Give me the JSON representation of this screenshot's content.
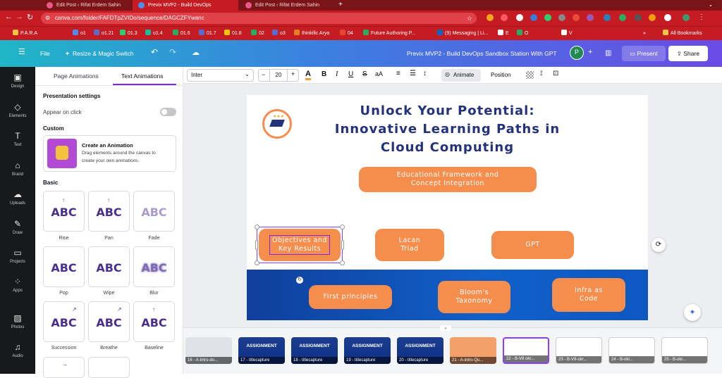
{
  "browser": {
    "tabs": [
      {
        "label": "Edit Post ‹ Rifat Erdem Sahin"
      },
      {
        "label": "Previx MVP2 - Build DevOps"
      },
      {
        "label": "Edit Post ‹ Rifat Erdem Sahin"
      }
    ],
    "url": "canva.com/folder/FAFDTpZVIDo/sequence/DAGCZFYwanc",
    "bookmarks": [
      "P.A.R.A",
      "o1",
      "o1.21",
      "01.3",
      "o1.4",
      "01.6",
      "01.7",
      "01.8",
      "02",
      "o3",
      "thinkific Arya",
      "04",
      "Future Authoring P...",
      "(9) Messaging | Li...",
      "E",
      "O",
      "V",
      "All Bookmarks"
    ],
    "colors": {
      "frame": "#c51c24"
    }
  },
  "header": {
    "menu_icon": "hamburger-icon",
    "file_label": "File",
    "resize_label": "Resize & Magic Switch",
    "doc_title": "Previx MVP2 - Build DevOps Sandbox Station  With GPT",
    "avatar_initial": "P",
    "present_label": "Present",
    "share_label": "Share"
  },
  "rail": {
    "items": [
      {
        "label": "Design",
        "icon": "design-icon"
      },
      {
        "label": "Elements",
        "icon": "elements-icon"
      },
      {
        "label": "Text",
        "icon": "text-icon"
      },
      {
        "label": "Brand",
        "icon": "brand-icon"
      },
      {
        "label": "Uploads",
        "icon": "uploads-icon"
      },
      {
        "label": "Draw",
        "icon": "draw-icon"
      },
      {
        "label": "Projects",
        "icon": "projects-icon"
      },
      {
        "label": "Apps",
        "icon": "apps-icon"
      },
      {
        "label": "Photos",
        "icon": "photos-icon"
      },
      {
        "label": "Audio",
        "icon": "audio-icon"
      }
    ]
  },
  "panel": {
    "tab_page": "Page Animations",
    "tab_text": "Text Animations",
    "presentation_settings": "Presentation settings",
    "appear_on_click": "Appear on click",
    "custom": "Custom",
    "create_title": "Create an Animation",
    "create_desc_1": "Drag elements around the canvas to",
    "create_desc_2": "create your own animations.",
    "basic": "Basic",
    "abc": "ABC",
    "animations": [
      "Rise",
      "Pan",
      "Fade",
      "Pop",
      "Wipe",
      "Blur",
      "Succession",
      "Breathe",
      "Baseline"
    ]
  },
  "toolbar": {
    "font": "Inter",
    "font_size": "20",
    "animate_label": "Animate",
    "position_label": "Position"
  },
  "slide": {
    "title_1": "Unlock Your Potential:",
    "title_2": "Innovative Learning Paths in",
    "title_3": "Cloud Computing",
    "framework_1": "Educational Framework and",
    "framework_2": "Concept Integration",
    "objectives_1": "Objectives and",
    "objectives_2": "Key Results",
    "lacan_1": "Lacan",
    "lacan_2": "Triad",
    "gpt": "GPT",
    "first_principles": "First principles",
    "bloom_1": "Bloom's",
    "bloom_2": "Taxonomy",
    "iac_1": "Infra as",
    "iac_2": "Code",
    "colors": {
      "title": "#23327a",
      "pill": "#f58d4d",
      "band": "#1160c9"
    }
  },
  "thumbnails": [
    {
      "label": "16 - A-intro-do...",
      "kind": "photo"
    },
    {
      "label": "17 - titlecapture",
      "kind": "blue",
      "text": "ASSIGNMENT"
    },
    {
      "label": "18 - titlecapture",
      "kind": "blue",
      "text": "ASSIGNMENT"
    },
    {
      "label": "19 - titlecapture",
      "kind": "blue",
      "text": "ASSIGNMENT"
    },
    {
      "label": "20 - titlecapture",
      "kind": "blue",
      "text": "ASSIGNMENT"
    },
    {
      "label": "21 - A-intro-Qu...",
      "kind": "orange"
    },
    {
      "label": "22 - B-V8 okr...",
      "kind": "current"
    },
    {
      "label": "23 - B-V9-okr...",
      "kind": "light"
    },
    {
      "label": "24 - B-okr...",
      "kind": "light"
    },
    {
      "label": "25 - B-okr...",
      "kind": "light"
    }
  ]
}
